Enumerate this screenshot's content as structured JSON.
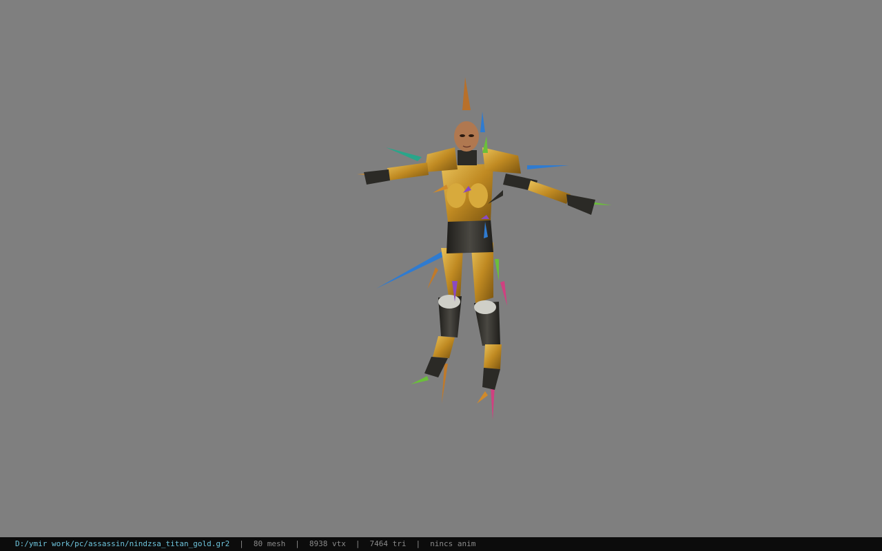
{
  "status_bar": {
    "file_path": "D:/ymir work/pc/assassin/nindzsa_titan_gold.gr2",
    "separator": "|",
    "mesh_count": "80 mesh",
    "vertex_count": "8938 vtx",
    "triangle_count": "7464 tri",
    "animation": "nincs anim"
  },
  "viewport": {
    "background": "#7f7f7f",
    "subject": "armored-character-model"
  },
  "colors": {
    "gold": "#c99a2e",
    "gold_dark": "#8a6414",
    "dark_armor": "#2b2a26",
    "skin": "#b07850",
    "path_text": "#6ec4dc",
    "status_text": "#8a8a8a"
  }
}
